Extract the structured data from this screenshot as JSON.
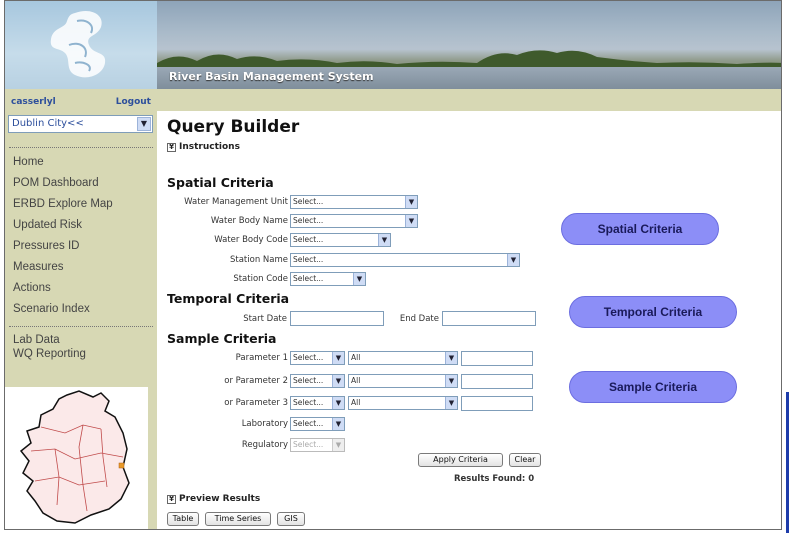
{
  "header": {
    "title": "River Basin Management System"
  },
  "sidebar": {
    "user": "casserlyl",
    "logout": "Logout",
    "city": "Dublin City<<",
    "nav": [
      {
        "label": "Home"
      },
      {
        "label": "POM Dashboard"
      },
      {
        "label": "ERBD Explore Map"
      },
      {
        "label": "Updated Risk"
      },
      {
        "label": "Pressures ID"
      },
      {
        "label": "Measures"
      },
      {
        "label": "Actions"
      },
      {
        "label": "Scenario Index"
      }
    ],
    "nav2": [
      {
        "label": "Lab Data"
      },
      {
        "label": "WQ Reporting"
      }
    ]
  },
  "main": {
    "title": "Query Builder",
    "instructions": "Instructions",
    "spatial": {
      "title": "Spatial Criteria",
      "water_management_unit": {
        "label": "Water Management Unit",
        "value": "Select..."
      },
      "water_body_name": {
        "label": "Water Body Name",
        "value": "Select..."
      },
      "water_body_code": {
        "label": "Water Body Code",
        "value": "Select..."
      },
      "station_name": {
        "label": "Station Name",
        "value": "Select..."
      },
      "station_code": {
        "label": "Station Code",
        "value": "Select..."
      }
    },
    "temporal": {
      "title": "Temporal Criteria",
      "start_date": "Start Date",
      "end_date": "End Date"
    },
    "sample": {
      "title": "Sample Criteria",
      "params": [
        {
          "label": "Parameter 1",
          "value": "Select...",
          "qualifier": "All"
        },
        {
          "label": "or Parameter 2",
          "value": "Select...",
          "qualifier": "All"
        },
        {
          "label": "or Parameter 3",
          "value": "Select...",
          "qualifier": "All"
        }
      ],
      "laboratory": {
        "label": "Laboratory",
        "value": "Select..."
      },
      "regulatory": {
        "label": "Regulatory",
        "value": "Select..."
      }
    },
    "apply_button": "Apply Criteria",
    "clear_button": "Clear",
    "results_found": "Results Found: 0",
    "preview": "Preview Results",
    "views": {
      "table": "Table",
      "time_series": "Time Series",
      "gis": "GIS"
    }
  },
  "callouts": {
    "spatial": "Spatial Criteria",
    "temporal": "Temporal Criteria",
    "sample": "Sample Criteria"
  },
  "colors": {
    "sidebar_bg": "#d7d8b4",
    "pill": "#8c8ef7",
    "link": "#2d4f9c"
  }
}
